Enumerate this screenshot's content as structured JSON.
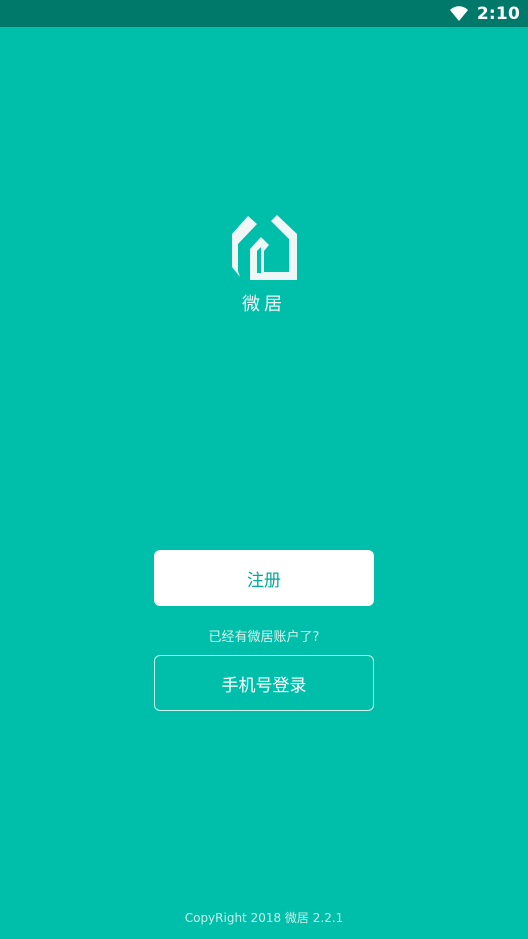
{
  "status_bar": {
    "time": "2:10",
    "icons": [
      "wifi-icon"
    ]
  },
  "logo": {
    "icon": "house-logo-icon",
    "color": "#eef7f5"
  },
  "app_name": "微居",
  "buttons": {
    "register_label": "注册",
    "phone_login_label": "手机号登录"
  },
  "prompt": "已经有微居账户了?",
  "footer": {
    "copyright": "CopyRight 2018 微居 2.2.1"
  },
  "colors": {
    "background": "#00bfaa",
    "status_bar": "#00796b",
    "accent_text": "#00a997"
  }
}
